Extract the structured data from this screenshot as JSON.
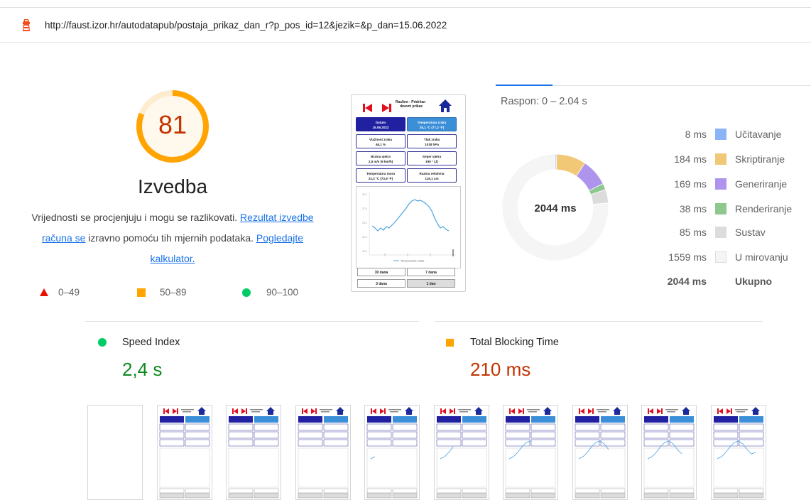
{
  "url": "http://faust.izor.hr/autodatapub/postaja_prikaz_dan_r?p_pos_id=12&jezik=&p_dan=15.06.2022",
  "gauge": {
    "score": "81",
    "category": "Izvedba",
    "fraction": 0.81,
    "color": "#ffa400"
  },
  "description": {
    "text1": "Vrijednosti se procjenjuju i mogu se razlikovati. ",
    "link1": "Rezultat izvedbe računa se",
    "text2": " izravno pomoću tih mjernih podataka. ",
    "link2": "Pogledajte kalkulator."
  },
  "score_legend": [
    {
      "icon": "red-triangle-icon",
      "label": "0–49",
      "color": "#eb0f00"
    },
    {
      "icon": "orange-square-icon",
      "label": "50–89",
      "color": "#ffa400"
    },
    {
      "icon": "green-circle-icon",
      "label": "90–100",
      "color": "#00cc66"
    }
  ],
  "phone_preview": {
    "title_line1": "Rasline - Pridržan",
    "title_line2": "dnevni prikaz",
    "cells": [
      {
        "label": "Datum",
        "value": "15.06.2022"
      },
      {
        "label": "Temperatura zraka",
        "value": "25,1 °C (77,2 °F)"
      },
      {
        "label": "Vlažnost zraka",
        "value": "46,1 %"
      },
      {
        "label": "Tlak zraka",
        "value": "1018 hPa"
      },
      {
        "label": "Brzina vjetra",
        "value": "2,5 m/s (9 km/h)"
      },
      {
        "label": "Smjer vjetra",
        "value": "190 ° (J)"
      },
      {
        "label": "Temperatura mora",
        "value": "23,3 °C (73,9 °F)"
      },
      {
        "label": "Razina relativna",
        "value": "115,1 cm"
      }
    ],
    "chart_legend": "Temperatura zraka",
    "buttons": [
      "30 dana",
      "7 dana",
      "3 dana",
      "1 dan"
    ]
  },
  "breakdown": {
    "range": "Raspon: 0 – 2.04 s",
    "total_label": "2044 ms",
    "rows": [
      {
        "value": "8 ms",
        "label": "Učitavanje",
        "color": "#8ab4f8",
        "ms": 8
      },
      {
        "value": "184 ms",
        "label": "Skriptiranje",
        "color": "#f1c876",
        "ms": 184
      },
      {
        "value": "169 ms",
        "label": "Generiranje",
        "color": "#af94ed",
        "ms": 169
      },
      {
        "value": "38 ms",
        "label": "Renderiranje",
        "color": "#8fc88f",
        "ms": 38
      },
      {
        "value": "85 ms",
        "label": "Sustav",
        "color": "#dcdcdc",
        "ms": 85
      },
      {
        "value": "1559 ms",
        "label": "U mirovanju",
        "color": "#f5f5f5",
        "ms": 1559
      }
    ],
    "total": {
      "value": "2044 ms",
      "label": "Ukupno"
    }
  },
  "metrics": [
    {
      "title": "Speed Index",
      "value": "2,4 s",
      "icon": "green-circle-icon",
      "color": "#0d8a1f"
    },
    {
      "title": "Total Blocking Time",
      "value": "210 ms",
      "icon": "orange-square-icon",
      "color": "#c33300"
    }
  ],
  "filmstrip": {
    "frames": 10,
    "chart_progress": [
      0,
      0,
      0,
      0,
      0.15,
      0.4,
      0.6,
      0.75,
      0.9,
      1
    ]
  }
}
